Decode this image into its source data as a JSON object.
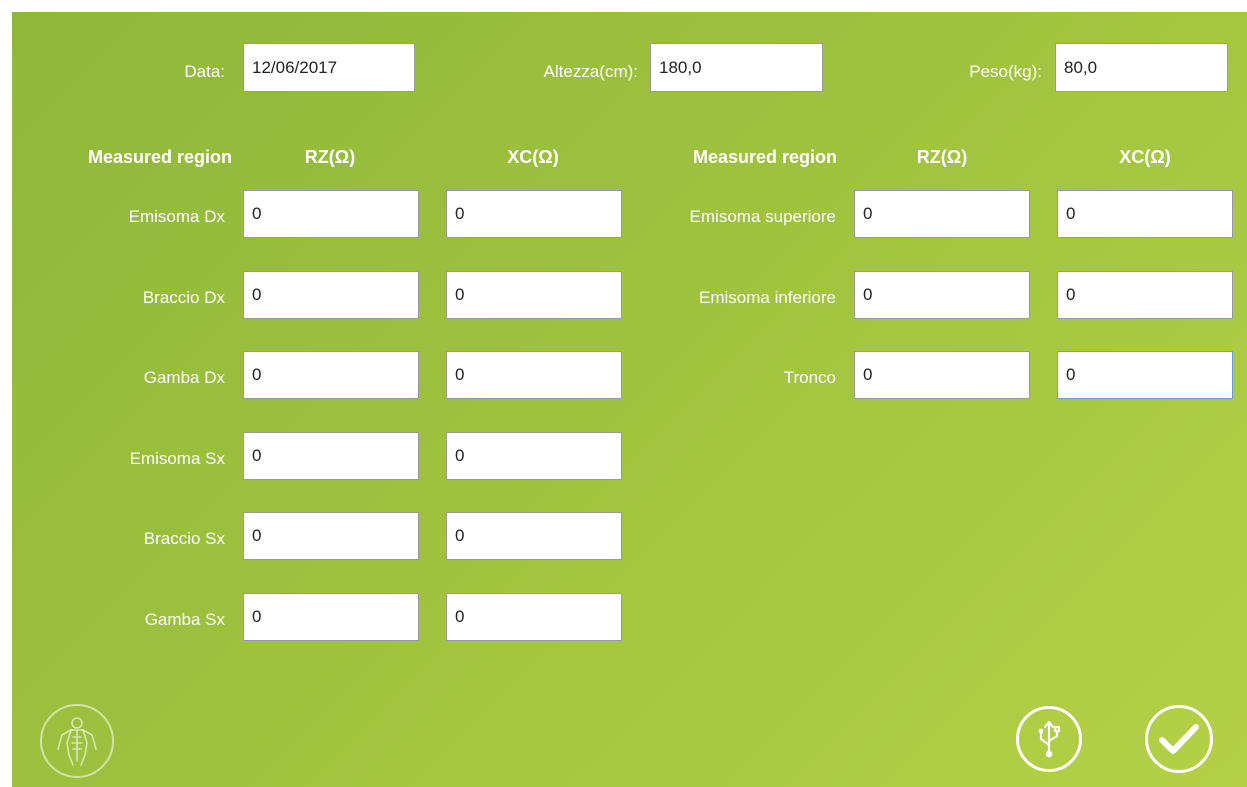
{
  "header": {
    "date": {
      "label": "Data:",
      "value": "12/06/2017"
    },
    "height": {
      "label": "Altezza(cm):",
      "value": "180,0"
    },
    "weight": {
      "label": "Peso(kg):",
      "value": "80,0"
    }
  },
  "columns": {
    "region": "Measured region",
    "rz": "RZ(Ω)",
    "xc": "XC(Ω)"
  },
  "left_rows": [
    {
      "label": "Emisoma Dx",
      "rz": "0",
      "xc": "0"
    },
    {
      "label": "Braccio Dx",
      "rz": "0",
      "xc": "0"
    },
    {
      "label": "Gamba Dx",
      "rz": "0",
      "xc": "0"
    },
    {
      "label": "Emisoma Sx",
      "rz": "0",
      "xc": "0"
    },
    {
      "label": "Braccio Sx",
      "rz": "0",
      "xc": "0"
    },
    {
      "label": "Gamba Sx",
      "rz": "0",
      "xc": "0"
    }
  ],
  "right_rows": [
    {
      "label": "Emisoma superiore",
      "rz": "0",
      "xc": "0"
    },
    {
      "label": "Emisoma inferiore",
      "rz": "0",
      "xc": "0"
    },
    {
      "label": "Tronco",
      "rz": "0",
      "xc": "0"
    }
  ],
  "footer": {
    "body_icon": "body-figure-icon",
    "usb_icon": "usb-icon",
    "confirm_icon": "checkmark-icon"
  },
  "colors": {
    "background_start": "#8fb73a",
    "background_end": "#b5d047",
    "text": "#ffffff"
  }
}
